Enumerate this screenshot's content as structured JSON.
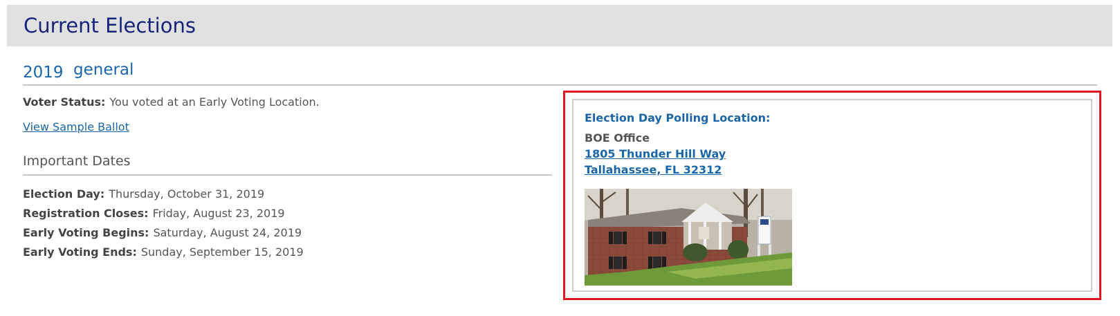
{
  "header": {
    "title": "Current Elections"
  },
  "election": {
    "year": "2019",
    "type": "general"
  },
  "voter_status": {
    "label": "Voter Status:",
    "value": "You voted at an Early Voting Location."
  },
  "sample_ballot_link": "View Sample Ballot",
  "important_dates": {
    "heading": "Important Dates",
    "items": [
      {
        "label": "Election Day:",
        "value": "Thursday, October 31, 2019"
      },
      {
        "label": "Registration Closes:",
        "value": "Friday, August 23, 2019"
      },
      {
        "label": "Early Voting Begins:",
        "value": "Saturday, August 24, 2019"
      },
      {
        "label": "Early Voting Ends:",
        "value": "Sunday, September 15, 2019"
      }
    ]
  },
  "polling_location": {
    "title": "Election Day Polling Location:",
    "name": "BOE Office",
    "address_line1": "1805 Thunder Hill Way",
    "address_line2": "Tallahassee, FL 32312",
    "photo_icon": "building-photo"
  },
  "colors": {
    "title_blue": "#17247b",
    "link_blue": "#1a66a8",
    "highlight_red": "#e0151f",
    "header_bg": "#e1e1e1"
  }
}
